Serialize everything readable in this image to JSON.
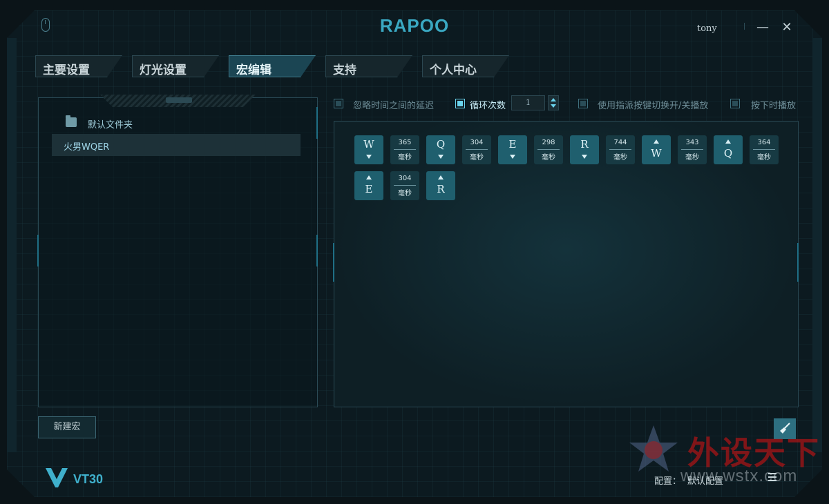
{
  "app": {
    "logo": "RAPOO",
    "user": "tony",
    "minimize_glyph": "—",
    "close_glyph": "✕"
  },
  "tabs": [
    {
      "label": "主要设置"
    },
    {
      "label": "灯光设置"
    },
    {
      "label": "宏编辑",
      "active": true
    },
    {
      "label": "支持"
    },
    {
      "label": "个人中心"
    }
  ],
  "macro_list": {
    "folder": "默认文件夹",
    "items": [
      {
        "label": "火男WQER",
        "selected": true
      }
    ],
    "new_button": "新建宏"
  },
  "options": {
    "ignore_delay": {
      "label": "忽略时间之间的延迟",
      "checked": false
    },
    "loop": {
      "label": "循环次数",
      "checked": true,
      "count": "1"
    },
    "toggle_assigned": {
      "label": "使用指派按键切换开/关播放",
      "checked": false
    },
    "play_while_pressed": {
      "label": "按下时播放",
      "checked": false
    }
  },
  "events": [
    {
      "type": "key",
      "key": "W",
      "action": "down"
    },
    {
      "type": "delay",
      "value": "365",
      "unit": "毫秒"
    },
    {
      "type": "key",
      "key": "Q",
      "action": "down"
    },
    {
      "type": "delay",
      "value": "304",
      "unit": "毫秒"
    },
    {
      "type": "key",
      "key": "E",
      "action": "down"
    },
    {
      "type": "delay",
      "value": "298",
      "unit": "毫秒"
    },
    {
      "type": "key",
      "key": "R",
      "action": "down"
    },
    {
      "type": "delay",
      "value": "744",
      "unit": "毫秒"
    },
    {
      "type": "key",
      "key": "W",
      "action": "up"
    },
    {
      "type": "delay",
      "value": "343",
      "unit": "毫秒"
    },
    {
      "type": "key",
      "key": "Q",
      "action": "up"
    },
    {
      "type": "delay",
      "value": "364",
      "unit": "毫秒"
    },
    {
      "type": "key",
      "key": "E",
      "action": "up"
    },
    {
      "type": "delay",
      "value": "304",
      "unit": "毫秒"
    },
    {
      "type": "key",
      "key": "R",
      "action": "up"
    }
  ],
  "footer": {
    "brand": "VT30",
    "config_label": "配置：",
    "config_value": "默认配置"
  },
  "watermark": {
    "text": "外设天下",
    "url": "www.wstx.com"
  },
  "icons": {
    "top_left": "mouse-icon",
    "clear": "broom-icon",
    "footer_menu": "menu-icon"
  },
  "colors": {
    "accent": "#3aa8c2",
    "key_bg": "#1f5f6e",
    "delay_bg": "#173a43",
    "checked": "#6ad3ec",
    "watermark": "#c81414"
  }
}
